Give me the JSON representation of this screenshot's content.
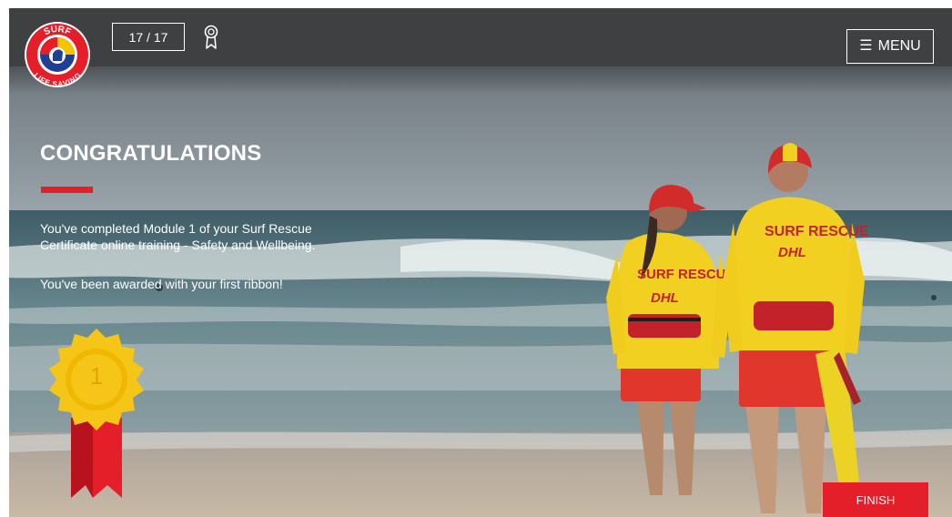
{
  "header": {
    "progress_counter": "17 / 17",
    "menu_label": "MENU",
    "logo": {
      "top_text": "SURF",
      "bottom_text": "LIFE SAVING",
      "colors": {
        "ring": "#e41f2a",
        "inner": "#1f3e94",
        "accent": "#f5c400"
      }
    }
  },
  "main": {
    "heading": "CONGRATULATIONS",
    "message_line1": "You've completed Module 1 of your Surf Rescue",
    "message_line2": "Certificate online training - Safety and Wellbeing.",
    "award_message": "You've been awarded with your first ribbon!",
    "medal_number": "1"
  },
  "footer": {
    "finish_label": "FINISH"
  },
  "photo": {
    "lifesaver_uniform_text": "SURF RESCUE",
    "sponsor_text": "DHL"
  },
  "colors": {
    "accent_red": "#e41f2a",
    "topbar": "#3f4042",
    "medal_gold": "#f5c518",
    "ribbon_red": "#d31f2b"
  },
  "icons": [
    "ribbon-icon",
    "menu-icon"
  ]
}
